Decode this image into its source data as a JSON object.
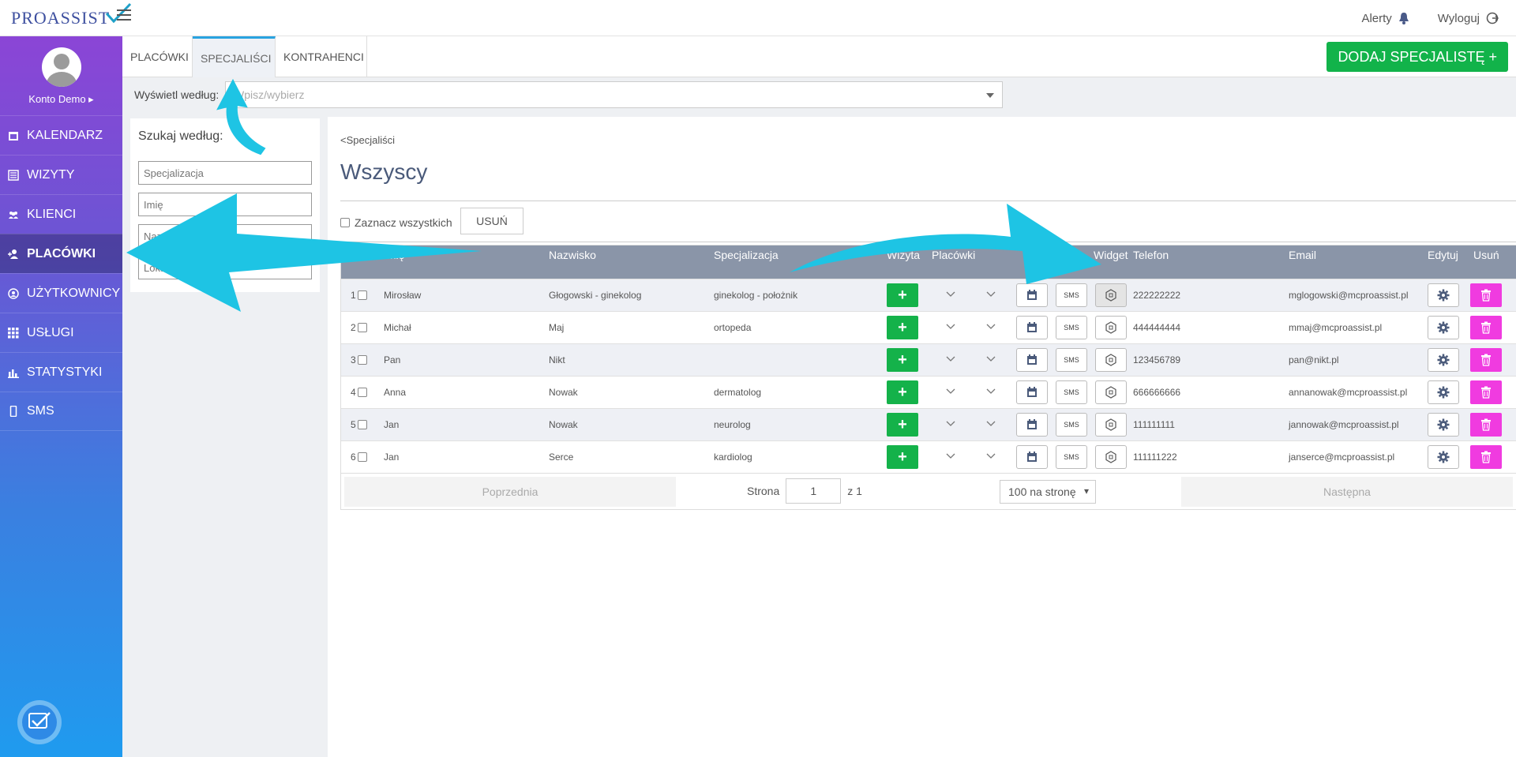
{
  "header": {
    "logo_text": "PROASSIST",
    "alerts_label": "Alerty",
    "logout_label": "Wyloguj"
  },
  "sidebar": {
    "profile_name": "Konto Demo ▸",
    "items": [
      {
        "label": "KALENDARZ",
        "icon": "calendar-icon"
      },
      {
        "label": "WIZYTY",
        "icon": "list-icon"
      },
      {
        "label": "KLIENCI",
        "icon": "users-icon"
      },
      {
        "label": "PLACÓWKI",
        "icon": "user-plus-icon",
        "active": true
      },
      {
        "label": "UŻYTKOWNICY",
        "icon": "user-circle-icon"
      },
      {
        "label": "USŁUGI",
        "icon": "grid-icon"
      },
      {
        "label": "STATYSTYKI",
        "icon": "bar-chart-icon"
      },
      {
        "label": "SMS",
        "icon": "phone-icon"
      }
    ]
  },
  "tabs": [
    {
      "label": "PLACÓWKI"
    },
    {
      "label": "SPECJALIŚCI",
      "active": true
    },
    {
      "label": "KONTRAHENCI"
    }
  ],
  "add_button_label": "DODAJ SPECJALISTĘ +",
  "filter": {
    "label": "Wyświetl według:",
    "placeholder": "Wpisz/wybierz"
  },
  "search": {
    "title": "Szukaj według:",
    "fields": [
      {
        "placeholder": "Specjalizacja"
      },
      {
        "placeholder": "Imię"
      },
      {
        "placeholder": "Nazwisko"
      },
      {
        "placeholder": "Lokalizacja placówki"
      }
    ]
  },
  "main": {
    "breadcrumb": "<Specjaliści",
    "title": "Wszyscy",
    "select_all_label": "Zaznacz wszystkich",
    "delete_label": "USUŃ"
  },
  "table": {
    "headers": {
      "first_name": "Imię",
      "last_name": "Nazwisko",
      "specialization": "Specjalizacja",
      "visit": "Wizyta",
      "facility": "Placówki",
      "widget": "Widget",
      "phone": "Telefon",
      "email": "Email",
      "edit": "Edytuj",
      "delete": "Usuń"
    },
    "sms_label": "SMS",
    "rows": [
      {
        "num": "1",
        "first": "Mirosław",
        "last": "Głogowski - ginekolog",
        "spec": "ginekolog - położnik",
        "phone": "222222222",
        "email": "mglogowski@mcproassist.pl"
      },
      {
        "num": "2",
        "first": "Michał",
        "last": "Maj",
        "spec": "ortopeda",
        "phone": "444444444",
        "email": "mmaj@mcproassist.pl"
      },
      {
        "num": "3",
        "first": "Pan",
        "last": "Nikt",
        "spec": "",
        "phone": "123456789",
        "email": "pan@nikt.pl"
      },
      {
        "num": "4",
        "first": "Anna",
        "last": "Nowak",
        "spec": "dermatolog",
        "phone": "666666666",
        "email": "annanowak@mcproassist.pl"
      },
      {
        "num": "5",
        "first": "Jan",
        "last": "Nowak",
        "spec": "neurolog",
        "phone": "111111111",
        "email": "jannowak@mcproassist.pl"
      },
      {
        "num": "6",
        "first": "Jan",
        "last": "Serce",
        "spec": "kardiolog",
        "phone": "111111222",
        "email": "janserce@mcproassist.pl"
      }
    ]
  },
  "pager": {
    "prev_label": "Poprzednia",
    "next_label": "Następna",
    "page_label": "Strona",
    "page_value": "1",
    "of_label": "z 1",
    "per_page_label": "100 na stronę"
  },
  "colors": {
    "green": "#12b34a",
    "pink": "#f03be0",
    "table_header": "#8a95a8",
    "annotation_arrow": "#1ec4e4"
  }
}
